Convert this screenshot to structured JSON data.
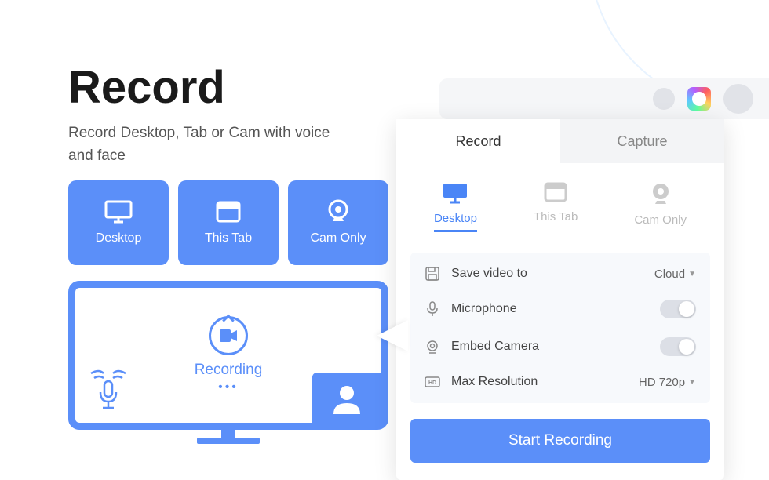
{
  "hero": {
    "title": "Record",
    "subtitle": "Record Desktop, Tab or Cam with voice and face"
  },
  "mode_cards": [
    {
      "label": "Desktop"
    },
    {
      "label": "This Tab"
    },
    {
      "label": "Cam Only"
    }
  ],
  "illustration": {
    "status": "Recording"
  },
  "popup": {
    "tabs": {
      "record": "Record",
      "capture": "Capture"
    },
    "sources": {
      "desktop": "Desktop",
      "this_tab": "This Tab",
      "cam_only": "Cam Only"
    },
    "settings": {
      "save_to_label": "Save video to",
      "save_to_value": "Cloud",
      "microphone_label": "Microphone",
      "embed_camera_label": "Embed Camera",
      "max_resolution_label": "Max Resolution",
      "max_resolution_value": "HD 720p"
    },
    "start_button": "Start Recording"
  }
}
